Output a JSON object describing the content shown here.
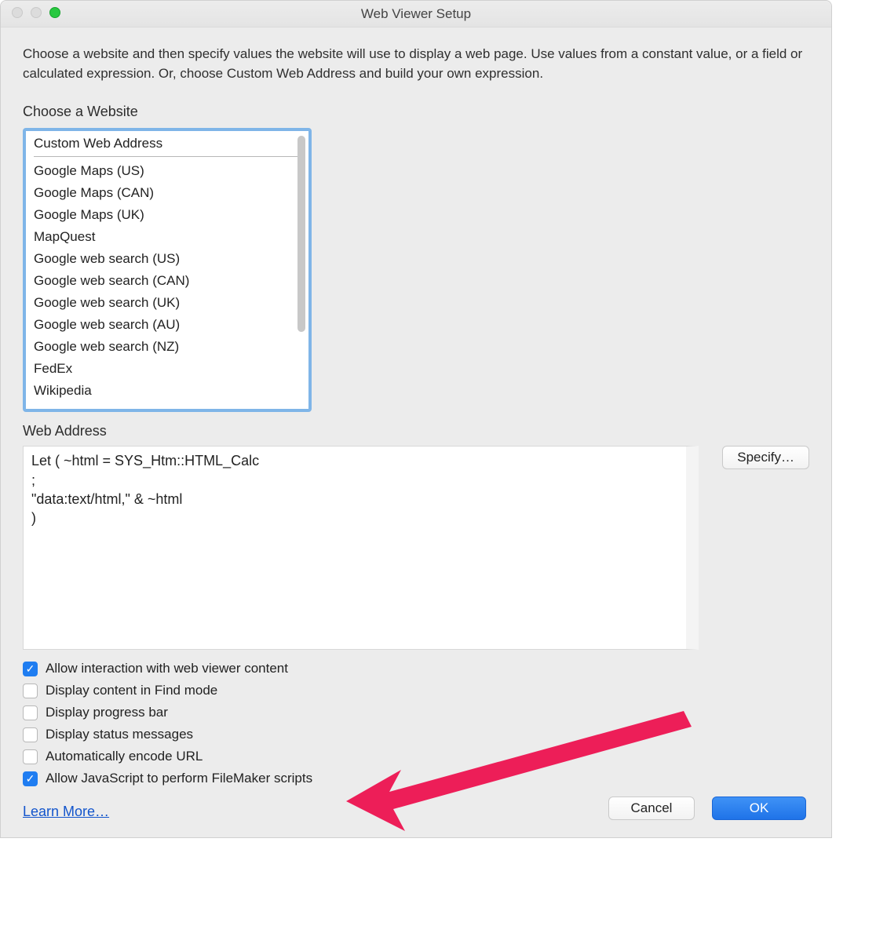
{
  "window": {
    "title": "Web Viewer Setup"
  },
  "intro": "Choose a website and then specify values the website will use to display a web page. Use values from a constant value, or a field or calculated expression. Or, choose Custom Web Address and build your own expression.",
  "choose_label": "Choose a Website",
  "websites": [
    "Custom Web Address",
    "Google Maps (US)",
    "Google Maps (CAN)",
    "Google Maps (UK)",
    "MapQuest",
    "Google web search (US)",
    "Google web search (CAN)",
    "Google web search (UK)",
    "Google web search (AU)",
    "Google web search (NZ)",
    "FedEx",
    "Wikipedia"
  ],
  "web_address_label": "Web Address",
  "web_address_value": "Let ( ~html = SYS_Htm::HTML_Calc\n;\n\"data:text/html,\" & ~html\n)",
  "buttons": {
    "specify": "Specify…",
    "cancel": "Cancel",
    "ok": "OK"
  },
  "checkboxes": [
    {
      "label": "Allow interaction with web viewer content",
      "checked": true
    },
    {
      "label": "Display content in Find mode",
      "checked": false
    },
    {
      "label": "Display progress bar",
      "checked": false
    },
    {
      "label": "Display status messages",
      "checked": false
    },
    {
      "label": "Automatically encode URL",
      "checked": false
    },
    {
      "label": "Allow JavaScript to perform FileMaker scripts",
      "checked": true
    }
  ],
  "learn_more": "Learn More…",
  "annotation": {
    "color": "#ed1e58"
  }
}
